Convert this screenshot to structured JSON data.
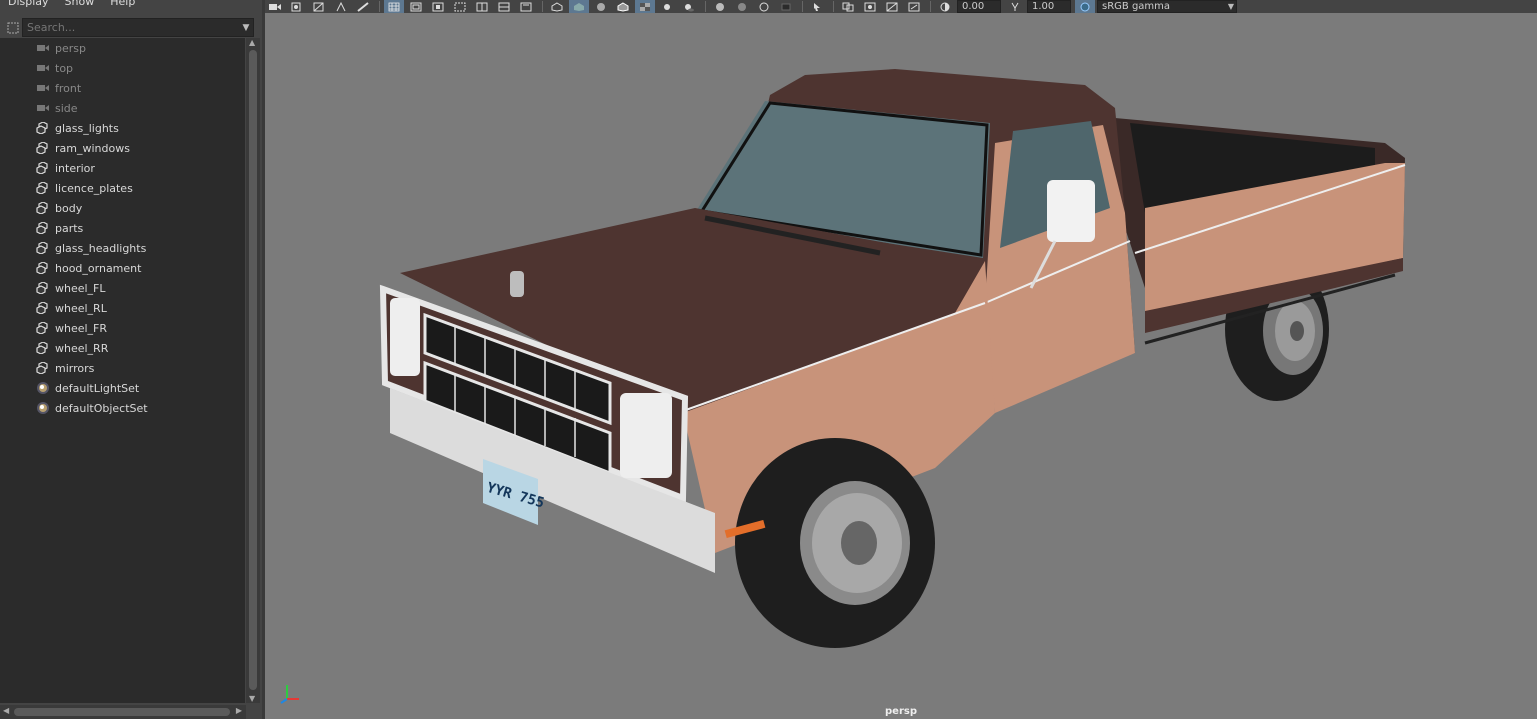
{
  "outliner": {
    "menu": [
      "Display",
      "Show",
      "Help"
    ],
    "search_placeholder": "Search...",
    "items": [
      {
        "label": "persp",
        "icon": "camera-icon",
        "dim": true
      },
      {
        "label": "top",
        "icon": "camera-icon",
        "dim": true
      },
      {
        "label": "front",
        "icon": "camera-icon",
        "dim": true
      },
      {
        "label": "side",
        "icon": "camera-icon",
        "dim": true
      },
      {
        "label": "glass_lights",
        "icon": "group-icon",
        "dim": false
      },
      {
        "label": "ram_windows",
        "icon": "group-icon",
        "dim": false
      },
      {
        "label": "interior",
        "icon": "group-icon",
        "dim": false
      },
      {
        "label": "licence_plates",
        "icon": "group-icon",
        "dim": false
      },
      {
        "label": "body",
        "icon": "group-icon",
        "dim": false
      },
      {
        "label": "parts",
        "icon": "group-icon",
        "dim": false
      },
      {
        "label": "glass_headlights",
        "icon": "group-icon",
        "dim": false
      },
      {
        "label": "hood_ornament",
        "icon": "group-icon",
        "dim": false
      },
      {
        "label": "wheel_FL",
        "icon": "group-icon",
        "dim": false
      },
      {
        "label": "wheel_RL",
        "icon": "group-icon",
        "dim": false
      },
      {
        "label": "wheel_FR",
        "icon": "group-icon",
        "dim": false
      },
      {
        "label": "wheel_RR",
        "icon": "group-icon",
        "dim": false
      },
      {
        "label": "mirrors",
        "icon": "group-icon",
        "dim": false
      },
      {
        "label": "defaultLightSet",
        "icon": "set-icon",
        "dim": false
      },
      {
        "label": "defaultObjectSet",
        "icon": "set-icon",
        "dim": false
      }
    ]
  },
  "toolbar": {
    "exposure_value": "0.00",
    "gamma_value": "1.00",
    "color_management": "sRGB gamma"
  },
  "viewport": {
    "camera_label": "persp",
    "license_plate": "YYR 755"
  },
  "colors": {
    "panel_bg": "#444444",
    "tree_bg": "#2b2b2b",
    "viewport_bg": "#7b7b7b",
    "active_button": "#5d7891",
    "truck_upper": "#4e3430",
    "truck_lower": "#c8937a"
  }
}
